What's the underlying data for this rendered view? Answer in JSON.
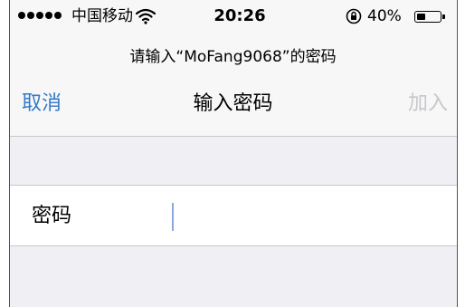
{
  "status_bar": {
    "carrier": "中国移动",
    "time": "20:26",
    "battery_percent_label": "40%",
    "battery_level": 0.4,
    "signal_bars": 5
  },
  "prompt": "请输入“MoFang9068”的密码",
  "nav": {
    "cancel_label": "取消",
    "title": "输入密码",
    "join_label": "加入"
  },
  "password_field": {
    "label": "密码",
    "value": "",
    "placeholder": ""
  },
  "colors": {
    "accent": "#3478c8",
    "disabled": "#c7c7cc",
    "header_bg": "#f7f7f7",
    "group_bg": "#efeff4",
    "caret": "#8ea6e0"
  },
  "icons": {
    "wifi": "wifi-icon",
    "rotation_lock": "rotation-lock-icon",
    "battery": "battery-icon"
  }
}
